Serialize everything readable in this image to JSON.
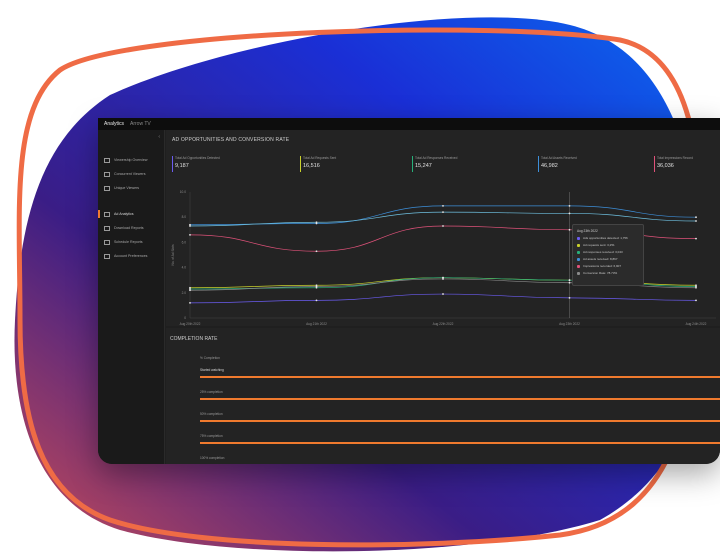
{
  "colors": {
    "accent": "#f07a2e",
    "blob_blue": "#0a57e6",
    "blob_purple": "#3a1d86",
    "blob_red": "#c54d55"
  },
  "window": {
    "app_tab": "Analytics",
    "second_tab": "Arrow TV"
  },
  "sidebar": {
    "collapse_icon": "chevron-left-icon",
    "items": [
      {
        "label": "Viewership Overview",
        "icon": "monitor-icon"
      },
      {
        "label": "Concurrent Viewers",
        "icon": "users-icon"
      },
      {
        "label": "Unique Viewers",
        "icon": "user-icon"
      },
      {
        "label": "Ad Analytics",
        "icon": "chart-icon",
        "active": true
      },
      {
        "label": "Download Reports",
        "icon": "download-icon"
      },
      {
        "label": "Schedule Reports",
        "icon": "clock-icon"
      },
      {
        "label": "Account Preferences",
        "icon": "gear-icon"
      }
    ]
  },
  "ad_panel": {
    "title": "AD OPPORTUNITIES AND CONVERSION RATE",
    "stats": [
      {
        "label": "Total Ad Opportunities Detected",
        "value": "9,187",
        "color": "#6b5cf0"
      },
      {
        "label": "Total Ad Requests Sent",
        "value": "16,516",
        "color": "#c9d12c"
      },
      {
        "label": "Total Ad Responses Received",
        "value": "15,247",
        "color": "#27b07a"
      },
      {
        "label": "Total Ad Assets Received",
        "value": "46,982",
        "color": "#3d8fd9"
      },
      {
        "label": "Total Impressions Record",
        "value": "36,036",
        "color": "#e0527a"
      }
    ]
  },
  "chart_data": {
    "type": "line",
    "ylabel": "No. of Ad Slots",
    "yticks": [
      "10.0",
      "8.0",
      "6.0",
      "4.0",
      "2.0",
      "0"
    ],
    "ylim": [
      0,
      10
    ],
    "categories": [
      "Aug 20th 2022",
      "Aug 21th 2022",
      "Aug 22th 2022",
      "Aug 23th 2022",
      "Aug 24th 2022"
    ],
    "series": [
      {
        "color": "#3d8fd9",
        "values": [
          7.4,
          7.5,
          8.9,
          8.9,
          8.0
        ]
      },
      {
        "color": "#6fc0e0",
        "values": [
          7.3,
          7.6,
          8.4,
          8.3,
          7.7
        ]
      },
      {
        "color": "#e0527a",
        "values": [
          6.6,
          5.3,
          7.3,
          7.0,
          6.3
        ]
      },
      {
        "color": "#c9d12c",
        "values": [
          2.4,
          2.6,
          3.2,
          3.0,
          2.6
        ]
      },
      {
        "color": "#27b07a",
        "values": [
          2.3,
          2.4,
          3.2,
          3.0,
          2.5
        ]
      },
      {
        "color": "#8a8a8a",
        "values": [
          2.2,
          2.5,
          3.1,
          2.8,
          2.4
        ]
      },
      {
        "color": "#6b5cf0",
        "values": [
          1.2,
          1.4,
          1.9,
          1.6,
          1.4
        ]
      }
    ]
  },
  "tooltip": {
    "title": "Aug 23th 2022",
    "rows": [
      {
        "text": "Ads opportunities detected: 1,756",
        "color": "#6b5cf0"
      },
      {
        "text": "Ad requests sent: 3,251",
        "color": "#c9d12c"
      },
      {
        "text": "Ad responses received: 3,043",
        "color": "#27b07a"
      },
      {
        "text": "Ad assets received: 8,867",
        "color": "#3d8fd9"
      },
      {
        "text": "Impressions recorded: 6,907",
        "color": "#e0527a"
      },
      {
        "text": "Conversion Rate: 78.73%",
        "color": "#8a8a8a"
      }
    ]
  },
  "completion_panel": {
    "title": "COMPLETION RATE",
    "header": "% Completion",
    "rows": [
      {
        "label": "Started watching",
        "fill": 1.0
      },
      {
        "label": "25% completion",
        "fill": 1.0
      },
      {
        "label": "50% completion",
        "fill": 1.0
      },
      {
        "label": "75% completion",
        "fill": 1.0
      },
      {
        "label": "100% completion",
        "fill": 1.0
      }
    ]
  }
}
